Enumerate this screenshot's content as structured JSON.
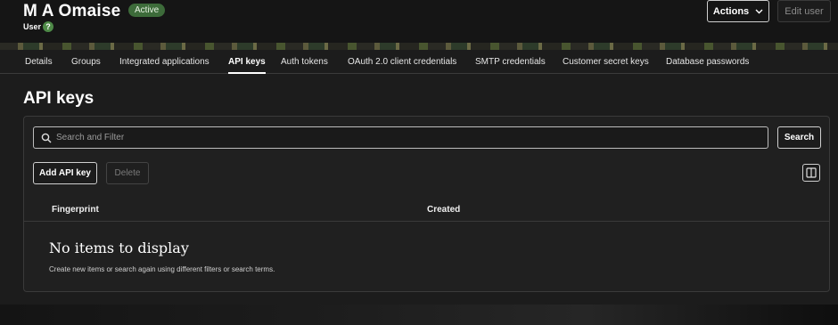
{
  "header": {
    "user_name": "M A Omaise",
    "status": "Active",
    "user_type": "User",
    "help_glyph": "?",
    "actions_label": "Actions",
    "edit_label": "Edit user",
    "status_color": "#3d6b3a"
  },
  "tabs": [
    {
      "label": "Details",
      "active": false
    },
    {
      "label": "Groups",
      "active": false
    },
    {
      "label": "Integrated applications",
      "active": false
    },
    {
      "label": "API keys",
      "active": true
    },
    {
      "label": "Auth tokens",
      "active": false
    },
    {
      "label": "OAuth 2.0 client credentials",
      "active": false
    },
    {
      "label": "SMTP credentials",
      "active": false
    },
    {
      "label": "Customer secret keys",
      "active": false
    },
    {
      "label": "Database passwords",
      "active": false
    }
  ],
  "main": {
    "title": "API keys",
    "search": {
      "placeholder": "Search and Filter",
      "value": ""
    },
    "search_button": "Search",
    "add_button": "Add API key",
    "delete_button": "Delete",
    "columns": [
      "Fingerprint",
      "Created"
    ],
    "empty_title": "No items to display",
    "empty_text": "Create new items or search again using different filters or search terms."
  },
  "icons": {
    "search": "search-icon",
    "actions_chevron": "chevron-down-icon",
    "columns": "columns-icon",
    "help": "help-icon"
  }
}
